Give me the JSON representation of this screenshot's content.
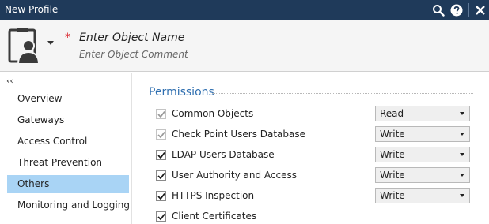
{
  "window": {
    "title": "New Profile"
  },
  "header": {
    "name_placeholder": "Enter Object Name",
    "comment_placeholder": "Enter Object Comment",
    "required_marker": "*"
  },
  "sidebar": {
    "collapse_glyph": "‹‹",
    "items": [
      {
        "label": "Overview",
        "active": false
      },
      {
        "label": "Gateways",
        "active": false
      },
      {
        "label": "Access Control",
        "active": false
      },
      {
        "label": "Threat Prevention",
        "active": false
      },
      {
        "label": "Others",
        "active": true
      },
      {
        "label": "Monitoring and Logging",
        "active": false
      }
    ]
  },
  "permissions": {
    "title": "Permissions",
    "rows": [
      {
        "label": "Common Objects",
        "checked": true,
        "disabled": true,
        "value": "Read"
      },
      {
        "label": "Check Point Users Database",
        "checked": true,
        "disabled": true,
        "value": "Write"
      },
      {
        "label": "LDAP Users Database",
        "checked": true,
        "disabled": false,
        "value": "Write"
      },
      {
        "label": "User Authority and Access",
        "checked": true,
        "disabled": false,
        "value": "Write"
      },
      {
        "label": "HTTPS Inspection",
        "checked": true,
        "disabled": false,
        "value": "Write"
      },
      {
        "label": "Client Certificates",
        "checked": true,
        "disabled": false,
        "value": ""
      }
    ]
  },
  "colors": {
    "titlebar": "#1f3a5a",
    "accent_title": "#2f6fb0",
    "active_nav": "#a9d4f5",
    "required": "#d9232a"
  },
  "icons": {
    "search": "search-icon",
    "help": "help-icon",
    "close": "close-icon",
    "avatar": "user-profile-icon"
  }
}
